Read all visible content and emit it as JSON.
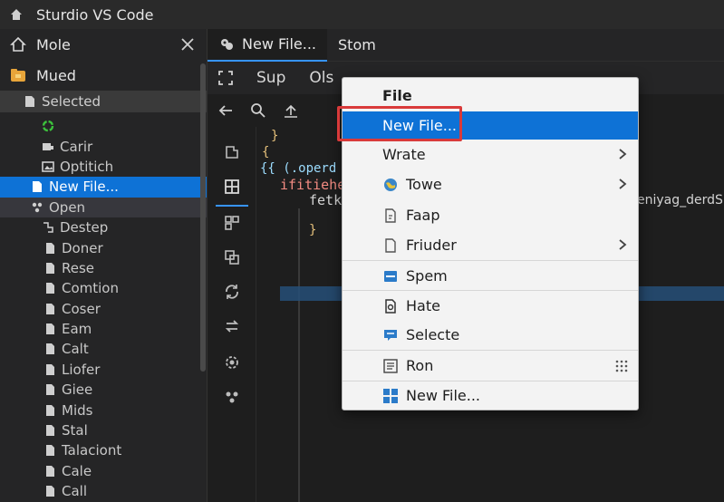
{
  "window": {
    "title": "Sturdio  VS Code"
  },
  "sidebar": {
    "header1": "Mole",
    "header2": "Mued",
    "section": "Selected",
    "items": [
      "",
      "Carir",
      "Optitich",
      "New File...",
      "Open",
      "Destep",
      "Doner",
      "Rese",
      "Comtion",
      "Coser",
      "Eam",
      "Calt",
      "Liofer",
      "Giee",
      "Mids",
      "Stal",
      "Talaciont",
      "Cale",
      "Call"
    ]
  },
  "tabs": [
    {
      "label": "New File..."
    },
    {
      "label": "Stom"
    }
  ],
  "menubar": {
    "items": [
      "Sup",
      "Ols"
    ]
  },
  "editor": {
    "lines": [
      "}",
      "{",
      "{{ (.operd",
      "ifitiehe",
      "fetk",
      "}"
    ],
    "trailing_text": "eniyag_derdS"
  },
  "context_menu": {
    "header": "File",
    "items": [
      {
        "label": "New File...",
        "icon": "none",
        "submenu": false,
        "highlighted": true
      },
      {
        "label": "Wrate",
        "icon": "none",
        "submenu": true
      },
      {
        "label": "Towe",
        "icon": "globe-icon",
        "submenu": true
      },
      {
        "label": "Faap",
        "icon": "file-copy-icon",
        "submenu": false
      },
      {
        "label": "Friuder",
        "icon": "file-icon",
        "submenu": true
      },
      {
        "label": "Spem",
        "icon": "window-icon",
        "submenu": false
      },
      {
        "label": "Hate",
        "icon": "file-edit-icon",
        "submenu": false
      },
      {
        "label": "Selecte",
        "icon": "comment-icon",
        "submenu": false
      },
      {
        "label": "Ron",
        "icon": "list-file-icon",
        "submenu": false,
        "grid": true
      },
      {
        "label": "New File...",
        "icon": "windows-grid-icon",
        "submenu": false
      }
    ]
  },
  "colors": {
    "accent": "#0e72d6",
    "highlight_box": "#d93a3a",
    "editor_bg": "#1e1e1e"
  }
}
